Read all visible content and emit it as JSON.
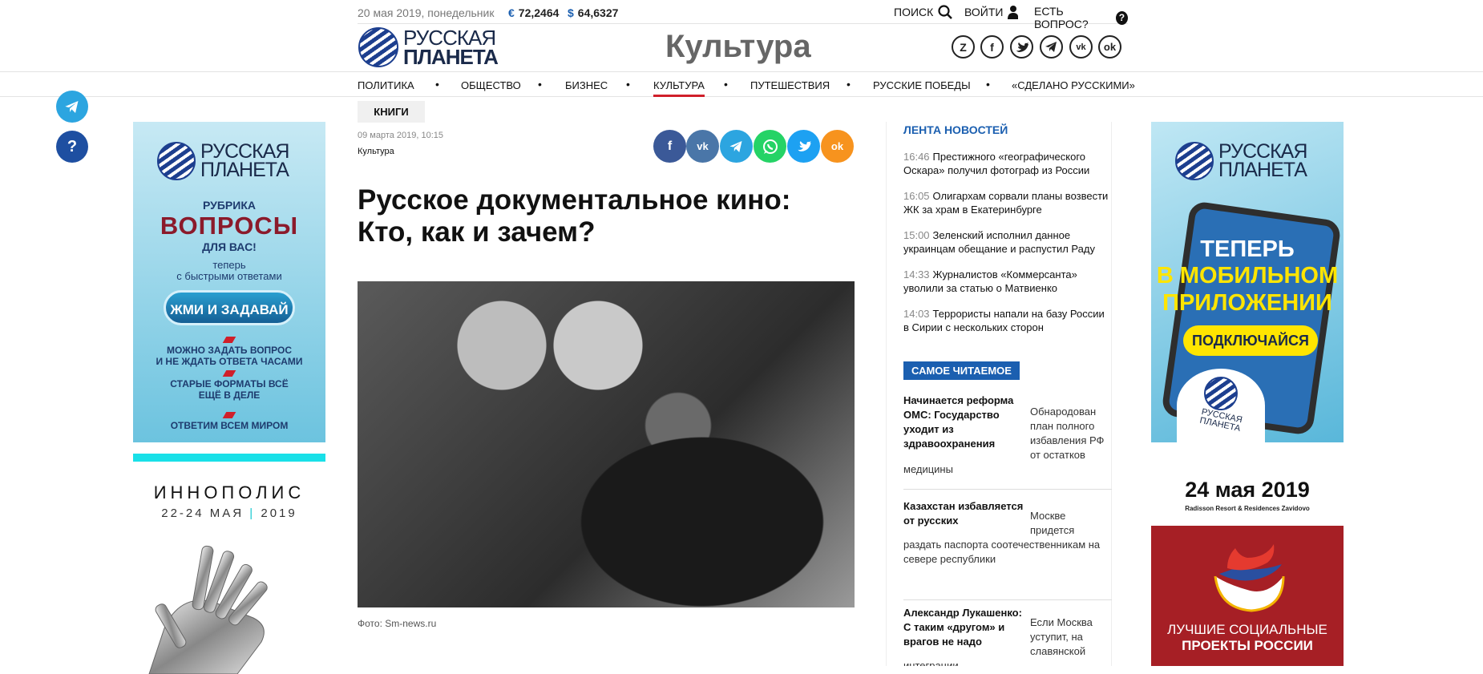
{
  "topbar": {
    "date": "20 мая 2019, понедельник",
    "euro_symbol": "€",
    "euro_rate": "72,2464",
    "usd_symbol": "$",
    "usd_rate": "64,6327",
    "search_label": "ПОИСК",
    "login_label": "ВОЙТИ",
    "question_label": "ЕСТЬ ВОПРОС?"
  },
  "header": {
    "logo_line1": "РУССКАЯ",
    "logo_line2": "ПЛАНЕТА",
    "section_title": "Культура",
    "social_icons": [
      "Z",
      "f",
      "t",
      "tg",
      "vk",
      "ok"
    ]
  },
  "nav": {
    "items": [
      "ПОЛИТИКА",
      "ОБЩЕСТВО",
      "БИЗНЕС",
      "КУЛЬТУРА",
      "ПУТЕШЕСТВИЯ",
      "РУССКИЕ ПОБЕДЫ",
      "«СДЕЛАНО РУССКИМИ»"
    ],
    "active": "КУЛЬТУРА",
    "separator": "•"
  },
  "float_buttons": {
    "telegram": "telegram-icon",
    "help": "?"
  },
  "banner_left": {
    "logo_line1": "РУССКАЯ",
    "logo_line2": "ПЛАНЕТА",
    "rubric": "РУБРИКА",
    "questions": "ВОПРОСЫ",
    "for_you": "ДЛЯ ВАС!",
    "now_line1": "теперь",
    "now_line2": "с быстрыми ответами",
    "button": "ЖМИ И ЗАДАВАЙ",
    "point1_line1": "МОЖНО ЗАДАТЬ ВОПРОС",
    "point1_line2": "И НЕ ЖДАТЬ ОТВЕТА ЧАСАМИ",
    "point2_line1": "СТАРЫЕ ФОРМАТЫ ВСЁ",
    "point2_line2": "ЕЩЁ В ДЕЛЕ",
    "point3": "ОТВЕТИМ ВСЕМ МИРОМ"
  },
  "innopolis": {
    "name": "ИННОПОЛИС",
    "dates": "22-24 МАЯ",
    "separator": "|",
    "year": "2019"
  },
  "article": {
    "tag": "КНИГИ",
    "date": "09 марта 2019, 10:15",
    "rubric": "Культура",
    "title_line1": "Русское документальное кино:",
    "title_line2": "Кто, как и зачем?",
    "photo_caption": "Фото: Sm-news.ru",
    "share_labels": [
      "f",
      "vk",
      "tg",
      "wa",
      "t",
      "ok"
    ]
  },
  "news_feed": {
    "title": "ЛЕНТА НОВОСТЕЙ",
    "items": [
      {
        "time": "16:46",
        "text": "Престижного «географического Оскара» получил фотограф из России"
      },
      {
        "time": "16:05",
        "text": "Олигархам сорвали планы возвести ЖК за храм в Екатеринбурге"
      },
      {
        "time": "15:00",
        "text": "Зеленский исполнил данное украинцам обещание и распустил Раду"
      },
      {
        "time": "14:33",
        "text": "Журналистов «Коммерсанта» уволили за статью о Матвиенко"
      },
      {
        "time": "14:03",
        "text": "Террористы напали на базу России в Сирии с нескольких сторон"
      }
    ]
  },
  "most_read": {
    "title": "САМОЕ ЧИТАЕМОЕ",
    "items": [
      {
        "headline": "Начинается реформа ОМС: Государство уходит из здравоохранения",
        "summary": "Обнародован план полного избавления РФ от остатков медицины"
      },
      {
        "headline": "Казахстан избавляется от русских",
        "summary": "Москве придется раздать паспорта соотечественникам на севере республики"
      },
      {
        "headline": "Александр Лукашенко: С таким «другом» и врагов не надо",
        "summary": "Если Москва уступит, на славянской интеграции"
      }
    ]
  },
  "banner_right": {
    "logo_line1": "РУССКАЯ",
    "logo_line2": "ПЛАНЕТА",
    "line1": "ТЕПЕРЬ",
    "line2": "В МОБИЛЬНОМ",
    "line3": "ПРИЛОЖЕНИИ",
    "button": "ПОДКЛЮЧАЙСЯ",
    "app_logo_line1": "РУССКАЯ",
    "app_logo_line2": "ПЛАНЕТА"
  },
  "event_banner": {
    "date": "24 мая 2019",
    "location": "Radisson Resort & Residences Zavidovo",
    "line1": "ЛУЧШИЕ СОЦИАЛЬНЫЕ",
    "line2": "ПРОЕКТЫ РОССИИ"
  },
  "colors": {
    "brand_blue": "#1b5fb0",
    "accent_red": "#d01f2a",
    "telegram": "#2ca5e0",
    "facebook": "#3b5998",
    "vk": "#4a76a8",
    "whatsapp": "#25d366",
    "twitter": "#1da1f2",
    "ok": "#f7931e"
  }
}
